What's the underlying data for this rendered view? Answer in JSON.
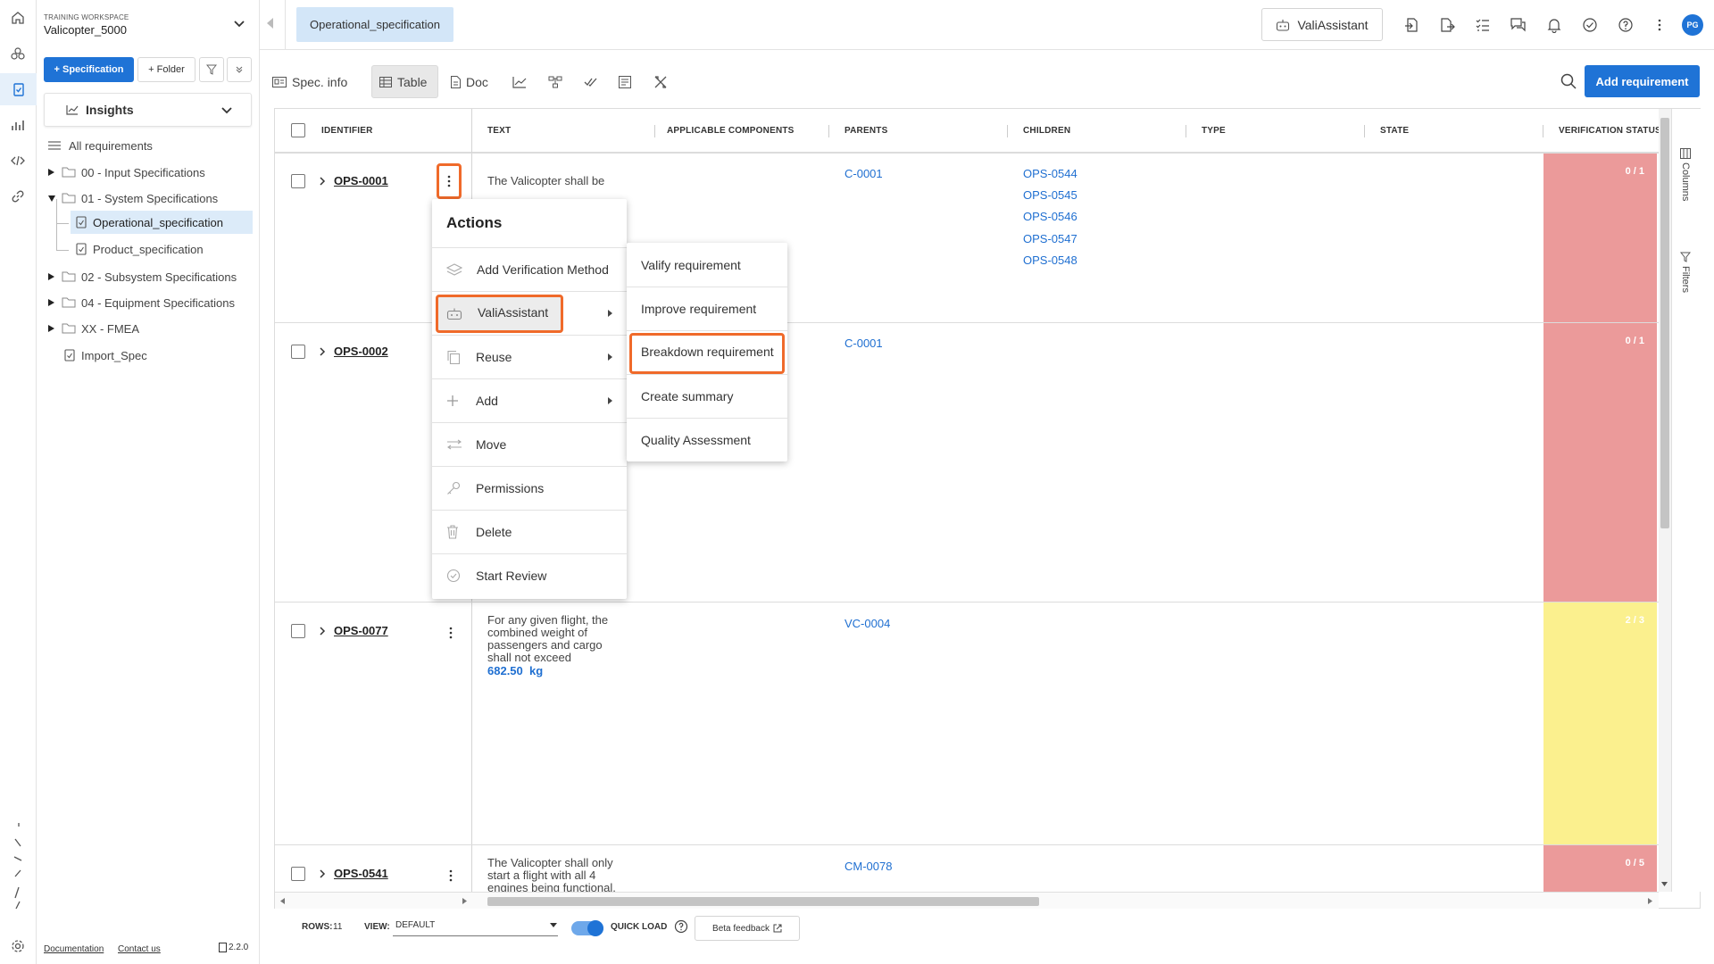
{
  "workspace": {
    "label": "TRAINING WORKSPACE",
    "name": "Valicopter_5000"
  },
  "sidebar": {
    "add_spec_label": "+ Specification",
    "add_folder_label": "+ Folder",
    "insights_label": "Insights",
    "tree": [
      {
        "label": "All requirements"
      },
      {
        "label": "00 - Input Specifications"
      },
      {
        "label": "01 - System Specifications"
      },
      {
        "label": "Operational_specification"
      },
      {
        "label": "Product_specification"
      },
      {
        "label": "02 - Subsystem Specifications"
      },
      {
        "label": "04 - Equipment Specifications"
      },
      {
        "label": "XX - FMEA"
      },
      {
        "label": "Import_Spec"
      }
    ],
    "footer": {
      "documentation": "Documentation",
      "contact": "Contact us",
      "version": "2.2.0"
    }
  },
  "topbar": {
    "tab_label": "Operational_specification",
    "assistant_label": "ValiAssistant",
    "avatar_initials": "PG"
  },
  "toolbar": {
    "spec_info": "Spec. info",
    "table": "Table",
    "doc": "Doc",
    "add_requirement": "Add requirement"
  },
  "table": {
    "headers": [
      "IDENTIFIER",
      "TEXT",
      "APPLICABLE COMPONENTS",
      "PARENTS",
      "CHILDREN",
      "TYPE",
      "STATE",
      "VERIFICATION STATUS"
    ],
    "rows": [
      {
        "id": "OPS-0001",
        "text": "The Valicopter shall be",
        "parents": [
          "C-0001"
        ],
        "children": [
          "OPS-0544",
          "OPS-0545",
          "OPS-0546",
          "OPS-0547",
          "OPS-0548"
        ],
        "verification": "0 / 1",
        "status_color": "#eb9a9a"
      },
      {
        "id": "OPS-0002",
        "text": "",
        "parents": [
          "C-0001"
        ],
        "children": [],
        "verification": "0 / 1",
        "status_color": "#eb9a9a"
      },
      {
        "id": "OPS-0077",
        "text": "For any given flight, the combined weight of passengers and cargo shall not exceed",
        "value": "682.50  kg",
        "parents": [
          "VC-0004"
        ],
        "children": [],
        "verification": "2 / 3",
        "status_color": "#fbf08e"
      },
      {
        "id": "OPS-0541",
        "text": "The Valicopter shall only start a flight with all 4 engines being functional.",
        "parents": [
          "CM-0078"
        ],
        "children": [],
        "verification": "0 / 5",
        "status_color": "#eb9a9a"
      }
    ],
    "side_tabs": {
      "columns": "Columns",
      "filters": "Filters"
    }
  },
  "actions_menu": {
    "title": "Actions",
    "items": [
      "Add Verification Method",
      "ValiAssistant",
      "Reuse",
      "Add",
      "Move",
      "Permissions",
      "Delete",
      "Start Review"
    ]
  },
  "submenu": {
    "items": [
      "Valify requirement",
      "Improve requirement",
      "Breakdown requirement",
      "Create summary",
      "Quality Assessment"
    ]
  },
  "footer": {
    "rows_label": "ROWS:",
    "rows_value": "11",
    "view_label": "VIEW:",
    "view_value": "DEFAULT",
    "quick_load": "QUICK LOAD",
    "beta_feedback": "Beta feedback"
  },
  "colors": {
    "accent": "#1f73d6",
    "highlight": "#f06a2a",
    "fail": "#eb9a9a",
    "partial": "#fbf08e"
  }
}
